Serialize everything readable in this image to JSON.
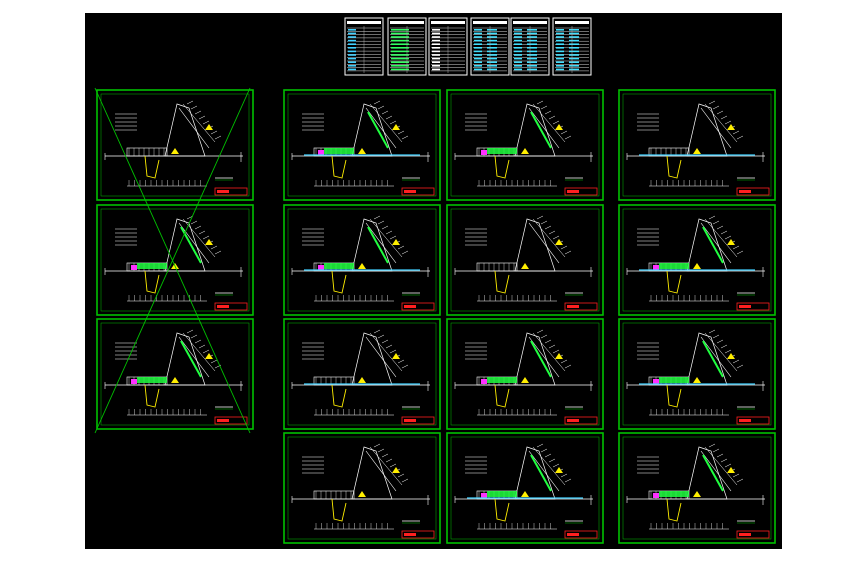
{
  "viewer": {
    "background_color": "#000000",
    "frame_color": "#00c000",
    "stamp_color": "#ff2020"
  },
  "legend_tables": [
    {
      "name": "cover-index"
    },
    {
      "name": "design-notes"
    },
    {
      "name": "material-list"
    },
    {
      "name": "equipment-schedule-1"
    },
    {
      "name": "equipment-schedule-2"
    },
    {
      "name": "equipment-schedule-3"
    }
  ],
  "drawing_sheets": [
    {
      "name": "sheet-r1c1",
      "crossed": true
    },
    {
      "name": "sheet-r1c2",
      "crossed": false
    },
    {
      "name": "sheet-r1c3",
      "crossed": false
    },
    {
      "name": "sheet-r1c4",
      "crossed": false
    },
    {
      "name": "sheet-r2c1",
      "crossed": true
    },
    {
      "name": "sheet-r2c2",
      "crossed": false
    },
    {
      "name": "sheet-r2c3",
      "crossed": false
    },
    {
      "name": "sheet-r2c4",
      "crossed": false
    },
    {
      "name": "sheet-r3c1",
      "crossed": true
    },
    {
      "name": "sheet-r3c2",
      "crossed": false
    },
    {
      "name": "sheet-r3c3",
      "crossed": false
    },
    {
      "name": "sheet-r3c4",
      "crossed": false
    },
    {
      "name": "sheet-r4c2",
      "crossed": false
    },
    {
      "name": "sheet-r4c3",
      "crossed": false
    },
    {
      "name": "sheet-r4c4",
      "crossed": false
    }
  ]
}
